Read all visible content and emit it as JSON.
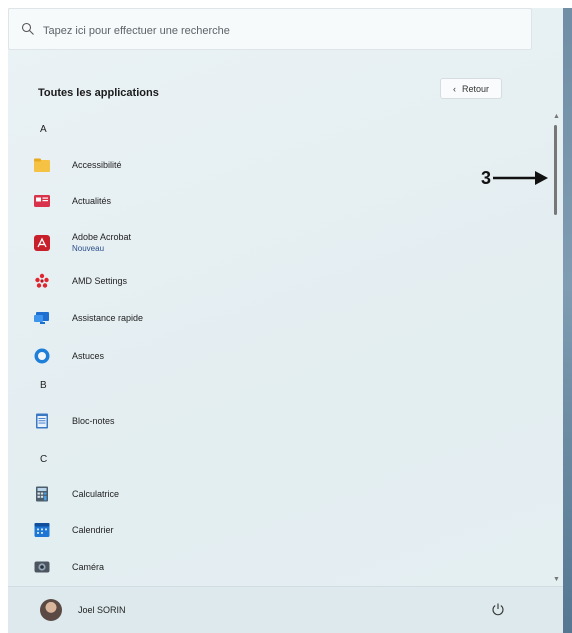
{
  "search": {
    "placeholder": "Tapez ici pour effectuer une recherche"
  },
  "header": {
    "title": "Toutes les applications",
    "back_label": "Retour"
  },
  "groups": [
    {
      "letter": "A"
    },
    {
      "letter": "B"
    },
    {
      "letter": "C"
    }
  ],
  "apps": [
    {
      "name": "Accessibilité",
      "icon": "folder-icon"
    },
    {
      "name": "Actualités",
      "icon": "news-icon"
    },
    {
      "name": "Adobe Acrobat",
      "subtitle": "Nouveau",
      "icon": "acrobat-icon"
    },
    {
      "name": "AMD Settings",
      "icon": "amd-icon"
    },
    {
      "name": "Assistance rapide",
      "icon": "quick-assist-icon"
    },
    {
      "name": "Astuces",
      "icon": "tips-icon"
    },
    {
      "name": "Bloc-notes",
      "icon": "notepad-icon"
    },
    {
      "name": "Calculatrice",
      "icon": "calculator-icon"
    },
    {
      "name": "Calendrier",
      "icon": "calendar-icon"
    },
    {
      "name": "Caméra",
      "icon": "camera-icon"
    }
  ],
  "annotation": {
    "number": "3"
  },
  "user": {
    "name": "Joel SORIN"
  }
}
